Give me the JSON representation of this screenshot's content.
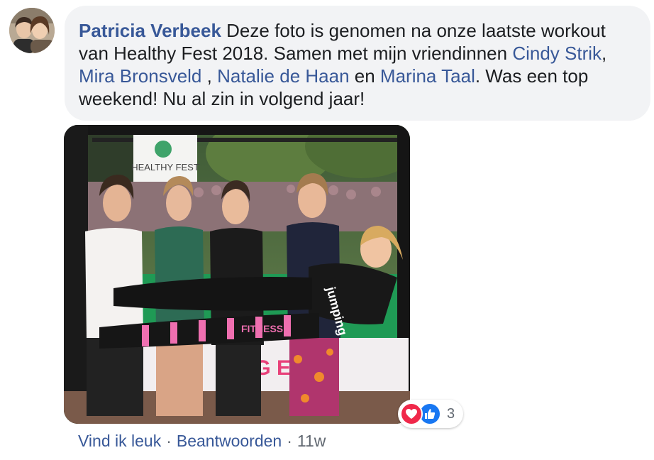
{
  "comment": {
    "author": "Patricia Verbeek",
    "text_1": " Deze foto is genomen na onze laatste workout van Healthy Fest 2018. Samen met mijn vriendinnen ",
    "mention_1": "Cindy Strik",
    "text_2": ", ",
    "mention_2": "Mira Bronsveld ",
    "text_3": ", ",
    "mention_3": "Natalie de Haan",
    "text_4": " en ",
    "mention_4": "Marina Taal",
    "text_5": ". Was een top weekend! Nu al zin in volgend jaar!"
  },
  "photo": {
    "sign_text": "HEALTHY FEST",
    "banner_text": "TU  G  ESSN",
    "shirt_text": "jumping",
    "legging_text": "FITNESS"
  },
  "reactions": {
    "icons": [
      "heart-icon",
      "thumbs-up-icon"
    ],
    "count": "3",
    "love_color": "#f0284a",
    "like_color": "#1877f2"
  },
  "actions": {
    "like_label": "Vind ik leuk",
    "separator": "·",
    "reply_label": "Beantwoorden",
    "timestamp": "11w"
  }
}
